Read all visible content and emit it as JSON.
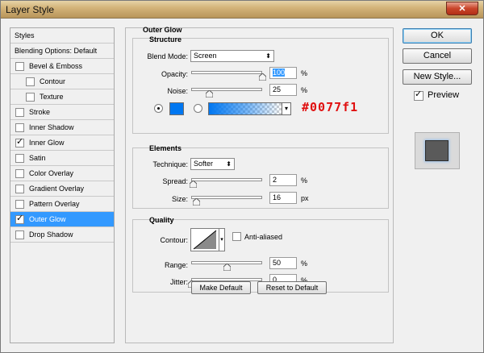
{
  "window": {
    "title": "Layer Style",
    "close_glyph": "✕"
  },
  "styles_list": {
    "header": "Styles",
    "blending": "Blending Options: Default",
    "items": [
      {
        "label": "Bevel & Emboss",
        "checked": false,
        "indent": false,
        "selected": false
      },
      {
        "label": "Contour",
        "checked": false,
        "indent": true,
        "selected": false
      },
      {
        "label": "Texture",
        "checked": false,
        "indent": true,
        "selected": false
      },
      {
        "label": "Stroke",
        "checked": false,
        "indent": false,
        "selected": false
      },
      {
        "label": "Inner Shadow",
        "checked": false,
        "indent": false,
        "selected": false
      },
      {
        "label": "Inner Glow",
        "checked": true,
        "indent": false,
        "selected": false
      },
      {
        "label": "Satin",
        "checked": false,
        "indent": false,
        "selected": false
      },
      {
        "label": "Color Overlay",
        "checked": false,
        "indent": false,
        "selected": false
      },
      {
        "label": "Gradient Overlay",
        "checked": false,
        "indent": false,
        "selected": false
      },
      {
        "label": "Pattern Overlay",
        "checked": false,
        "indent": false,
        "selected": false
      },
      {
        "label": "Outer Glow",
        "checked": true,
        "indent": false,
        "selected": true
      },
      {
        "label": "Drop Shadow",
        "checked": false,
        "indent": false,
        "selected": false
      }
    ]
  },
  "outer_glow": {
    "title": "Outer Glow",
    "structure": {
      "heading": "Structure",
      "blend_mode_label": "Blend Mode:",
      "blend_mode_value": "Screen",
      "opacity_label": "Opacity:",
      "opacity_value": "100",
      "opacity_level": 1.0,
      "noise_label": "Noise:",
      "noise_value": "25",
      "noise_level": 0.25,
      "percent": "%",
      "color_hex": "#0077f1",
      "color_annotation": "#0077f1"
    },
    "elements": {
      "heading": "Elements",
      "technique_label": "Technique:",
      "technique_value": "Softer",
      "spread_label": "Spread:",
      "spread_value": "2",
      "spread_level": 0.02,
      "size_label": "Size:",
      "size_value": "16",
      "size_level": 0.064,
      "percent": "%",
      "px": "px"
    },
    "quality": {
      "heading": "Quality",
      "contour_label": "Contour:",
      "anti_aliased_label": "Anti-aliased",
      "anti_aliased_checked": false,
      "range_label": "Range:",
      "range_value": "50",
      "range_level": 0.5,
      "jitter_label": "Jitter:",
      "jitter_value": "0",
      "jitter_level": 0.0,
      "percent": "%"
    },
    "make_default": "Make Default",
    "reset_default": "Reset to Default"
  },
  "actions": {
    "ok": "OK",
    "cancel": "Cancel",
    "new_style": "New Style...",
    "preview_label": "Preview",
    "preview_checked": true
  }
}
